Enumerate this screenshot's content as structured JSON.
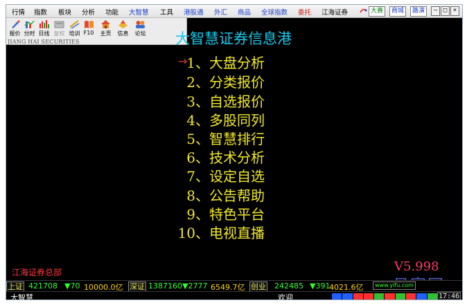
{
  "menu": [
    {
      "label": "行情",
      "color": "normal"
    },
    {
      "label": "指数",
      "color": "normal"
    },
    {
      "label": "板块",
      "color": "normal"
    },
    {
      "label": "分析",
      "color": "normal"
    },
    {
      "label": "功能",
      "color": "normal"
    },
    {
      "label": "大智慧",
      "color": "blue"
    },
    {
      "label": "工具",
      "color": "normal"
    },
    {
      "label": "港股通",
      "color": "blue"
    },
    {
      "label": "外汇",
      "color": "blue"
    },
    {
      "label": "商品",
      "color": "blue"
    },
    {
      "label": "全球指数",
      "color": "blue"
    },
    {
      "label": "委托",
      "color": "red"
    },
    {
      "label": "江海证券",
      "color": "normal"
    }
  ],
  "top_buttons": [
    "大赛",
    "商城",
    "路演"
  ],
  "window_controls": [
    "—",
    "□",
    "×"
  ],
  "toolbar": [
    {
      "label": "报价",
      "icon": "pen-icon",
      "dim": false
    },
    {
      "label": "分时",
      "icon": "line-chart-icon",
      "dim": false
    },
    {
      "label": "日线",
      "icon": "candlestick-icon",
      "dim": false
    },
    {
      "label": "复权",
      "icon": "restore-icon",
      "dim": true
    },
    {
      "label": "培训",
      "icon": "training-icon",
      "dim": false
    },
    {
      "label": "F10",
      "icon": "f10-book-icon",
      "dim": false
    },
    {
      "label": "主页",
      "icon": "home-icon",
      "dim": false
    },
    {
      "label": "信息",
      "icon": "info-icon",
      "dim": false
    },
    {
      "label": "论坛",
      "icon": "forum-icon",
      "dim": false
    }
  ],
  "brand_text": "JIANG HAI SECURITIES",
  "main_title": "大智慧证券信息港",
  "selection_arrow": "→",
  "main_menu": [
    {
      "num": "1、",
      "label": "大盘分析"
    },
    {
      "num": "2、",
      "label": "分类报价"
    },
    {
      "num": "3、",
      "label": "自选报价"
    },
    {
      "num": "4、",
      "label": "多股同列"
    },
    {
      "num": "5、",
      "label": "智慧排行"
    },
    {
      "num": "6、",
      "label": "技术分析"
    },
    {
      "num": "7、",
      "label": "设定自选"
    },
    {
      "num": "8、",
      "label": "公告帮助"
    },
    {
      "num": "9、",
      "label": "特色平台"
    },
    {
      "num": "10、",
      "label": "电视直播"
    }
  ],
  "footer_left": "江海证券总部",
  "version": "V5.998",
  "watermark": "易富网",
  "ticker": {
    "sh_label": "上证",
    "sh_value": "421708",
    "sh_change": "▼70",
    "sh_turnover": "10000.0亿",
    "sz_label": "深证",
    "sz_value": "1387160",
    "sz_change": "▼2777",
    "sz_turnover": "6549.7亿",
    "cy_label": "创业",
    "cy_value": "242485",
    "cy_change": "▼391",
    "cy_turnover": "4021.6亿",
    "site": "www.yifu.com"
  },
  "status": {
    "left": "大智慧",
    "welcome": "欢迎",
    "time": "17:46"
  },
  "colors": {
    "title": "#19c6ea",
    "menu_text": "#f0e82a",
    "arrow": "#e23b3b",
    "version": "#ff3a6a",
    "footer": "#ff3a3a"
  }
}
